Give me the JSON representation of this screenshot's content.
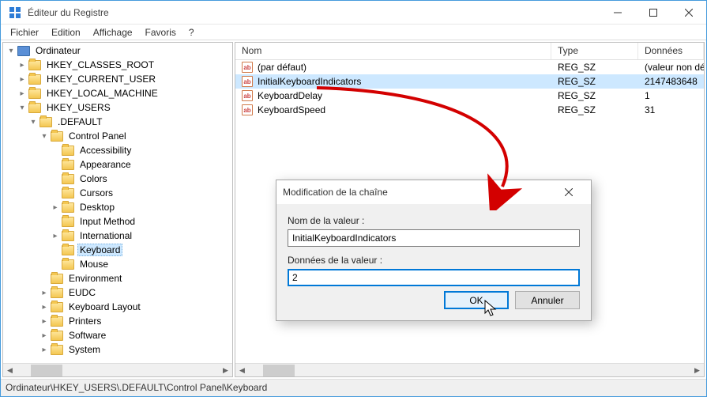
{
  "window": {
    "title": "Éditeur du Registre"
  },
  "menu": {
    "file": "Fichier",
    "edit": "Edition",
    "view": "Affichage",
    "favorites": "Favoris",
    "help": "?"
  },
  "tree": {
    "root": "Ordinateur",
    "hkcr": "HKEY_CLASSES_ROOT",
    "hkcu": "HKEY_CURRENT_USER",
    "hklm": "HKEY_LOCAL_MACHINE",
    "hku": "HKEY_USERS",
    "default": ".DEFAULT",
    "control_panel": "Control Panel",
    "cp_items": [
      "Accessibility",
      "Appearance",
      "Colors",
      "Cursors",
      "Desktop",
      "Input Method",
      "International",
      "Keyboard",
      "Mouse"
    ],
    "environment": "Environment",
    "eudc": "EUDC",
    "keyboard_layout": "Keyboard Layout",
    "printers": "Printers",
    "software": "Software",
    "system": "System"
  },
  "list": {
    "cols": {
      "name": "Nom",
      "type": "Type",
      "data": "Données"
    },
    "rows": [
      {
        "name": "(par défaut)",
        "type": "REG_SZ",
        "data": "(valeur non définie)",
        "sel": false
      },
      {
        "name": "InitialKeyboardIndicators",
        "type": "REG_SZ",
        "data": "2147483648",
        "sel": true
      },
      {
        "name": "KeyboardDelay",
        "type": "REG_SZ",
        "data": "1",
        "sel": false
      },
      {
        "name": "KeyboardSpeed",
        "type": "REG_SZ",
        "data": "31",
        "sel": false
      }
    ]
  },
  "dialog": {
    "title": "Modification de la chaîne",
    "name_label": "Nom de la valeur :",
    "name_value": "InitialKeyboardIndicators",
    "data_label": "Données de la valeur :",
    "data_value": "2",
    "ok": "OK",
    "cancel": "Annuler"
  },
  "statusbar": "Ordinateur\\HKEY_USERS\\.DEFAULT\\Control Panel\\Keyboard"
}
